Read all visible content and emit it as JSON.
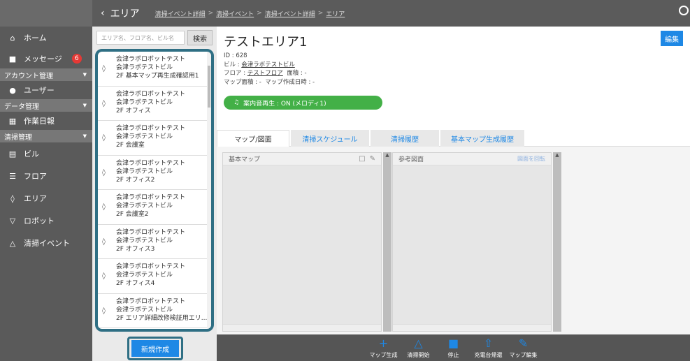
{
  "topbar": {
    "back_label": "エリア",
    "crumbs": [
      "清掃イベント詳細",
      "清掃イベント",
      "清掃イベント詳細",
      "エリア"
    ],
    "separator": ">"
  },
  "sidebar": {
    "home": "ホーム",
    "messages": "メッセージ",
    "messages_badge": "6",
    "section_account": "アカウント管理",
    "users": "ユーザー",
    "section_data": "データ管理",
    "daily_report": "作業日報",
    "section_cleaning": "清掃管理",
    "building": "ビル",
    "floor": "フロア",
    "area": "エリア",
    "robot": "ロボット",
    "cleaning_event": "清掃イベント"
  },
  "list": {
    "search_placeholder": "エリア名、フロア名、ビル名",
    "search_button": "検索",
    "items": [
      {
        "l1": "会津ラボロボットテスト",
        "l2": "会津ラボテストビル",
        "l3": "2F 基本マップ再生成確認用1"
      },
      {
        "l1": "会津ラボロボットテスト",
        "l2": "会津ラボテストビル",
        "l3": "2F オフィス"
      },
      {
        "l1": "会津ラボロボットテスト",
        "l2": "会津ラボテストビル",
        "l3": "2F 会議室"
      },
      {
        "l1": "会津ラボロボットテスト",
        "l2": "会津ラボテストビル",
        "l3": "2F オフィス2"
      },
      {
        "l1": "会津ラボロボットテスト",
        "l2": "会津ラボテストビル",
        "l3": "2F 会議室2"
      },
      {
        "l1": "会津ラボロボットテスト",
        "l2": "会津ラボテストビル",
        "l3": "2F オフィス3"
      },
      {
        "l1": "会津ラボロボットテスト",
        "l2": "会津ラボテストビル",
        "l3": "2F オフィス4"
      },
      {
        "l1": "会津ラボロボットテスト",
        "l2": "会津ラボテストビル",
        "l3": "2F エリア詳細改修検証用エリ..."
      }
    ],
    "new_button": "新規作成"
  },
  "detail": {
    "title": "テストエリア1",
    "edit_button": "編集",
    "id_line": "ID : 628",
    "building_prefix": "ビル : ",
    "building_link": "会津ラボテストビル",
    "floor_prefix": "フロア : ",
    "floor_link": "テストフロア",
    "area_size": "面積 : -",
    "map_size": "マップ面積 : -",
    "map_created": "マップ作成日時 : -",
    "sound": "案内音再生 : ON (メロディ1)"
  },
  "tabs": [
    "マップ/図面",
    "清掃スケジュール",
    "清掃履歴",
    "基本マップ生成履歴"
  ],
  "panels": {
    "basic_map": "基本マップ",
    "reference": "参考図面",
    "rotate": "図面を回転"
  },
  "tools": [
    "マップ生成",
    "清掃開始",
    "停止",
    "充電台帰還",
    "マップ編集"
  ]
}
